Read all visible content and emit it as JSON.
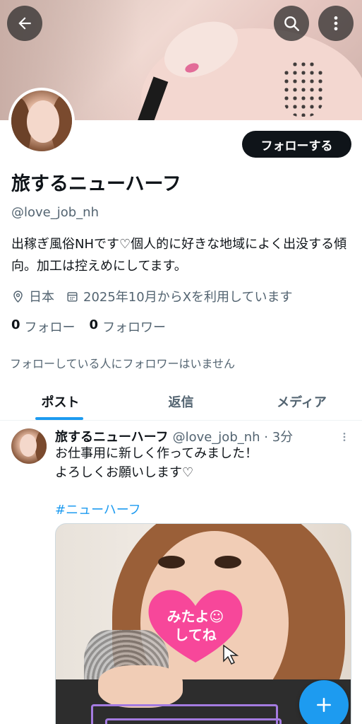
{
  "header": {
    "back_icon": "arrow-left-icon",
    "search_icon": "search-icon",
    "more_icon": "more-vertical-icon"
  },
  "profile": {
    "display_name": "旅するニューハーフ",
    "handle": "@love_job_nh",
    "bio": "出稼ぎ風俗NHです♡個人的に好きな地域によく出没する傾向。加工は控えめにしてます。",
    "location": "日本",
    "joined": "2025年10月からXを利用しています",
    "following_count": "0",
    "following_label": "フォロー",
    "followers_count": "0",
    "followers_label": "フォロワー",
    "followed_by_note": "フォローしている人にフォロワーはいません",
    "follow_button": "フォローする"
  },
  "tabs": [
    {
      "label": "ポスト",
      "active": true
    },
    {
      "label": "返信",
      "active": false
    },
    {
      "label": "メディア",
      "active": false
    }
  ],
  "post": {
    "author_name": "旅するニューハーフ",
    "author_handle": "@love_job_nh · 3分",
    "text_line1": "お仕事用に新しく作ってみました！",
    "text_line2": "よろしくお願いします♡",
    "hashtag": "#ニューハーフ",
    "image_sticker_line1": "みたよ☺",
    "image_sticker_line2": "してね"
  },
  "fab": {
    "icon": "plus-icon"
  },
  "colors": {
    "accent": "#1d9bf0",
    "text_primary": "#0f1419",
    "text_secondary": "#536471"
  }
}
